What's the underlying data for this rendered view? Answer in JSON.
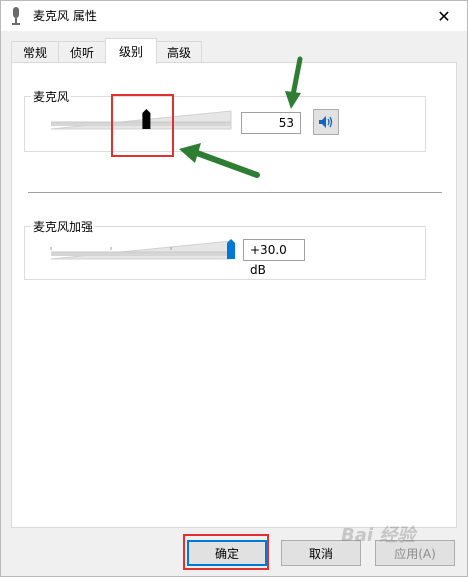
{
  "window": {
    "title": "麦克风 属性",
    "close_glyph": "✕"
  },
  "tabs": [
    {
      "label": "常规"
    },
    {
      "label": "侦听"
    },
    {
      "label": "级别"
    },
    {
      "label": "高级"
    }
  ],
  "active_tab": "级别",
  "microphone": {
    "label": "麦克风",
    "value": "53",
    "level": 0.53,
    "thumb_color": "#000000"
  },
  "boost": {
    "label": "麦克风加强",
    "value": "+30.0 dB",
    "level": 1.0,
    "thumb_color": "#0078d7"
  },
  "buttons": {
    "ok": "确定",
    "cancel": "取消",
    "apply": "应用(A)"
  },
  "colors": {
    "annotation_red": "#e03030",
    "annotation_green": "#2e7d32",
    "accent": "#0078d7"
  },
  "watermark": "Bai 经验"
}
